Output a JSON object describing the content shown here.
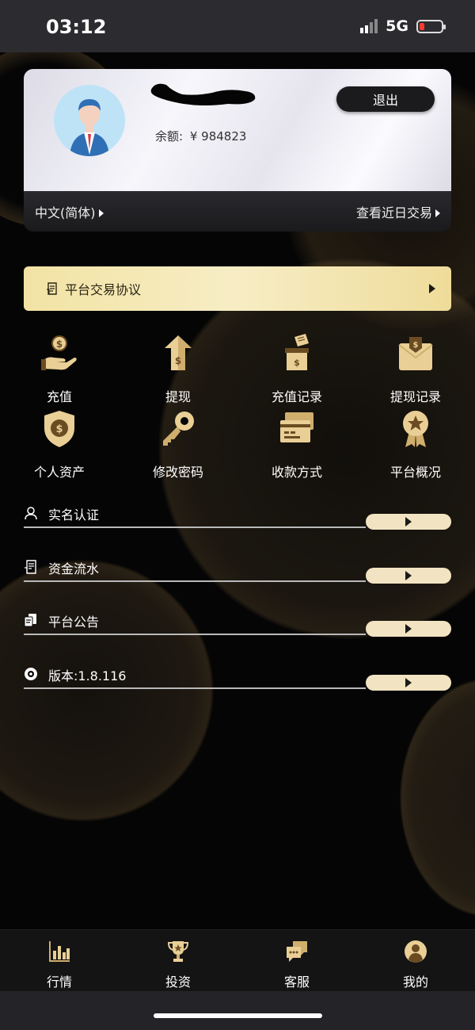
{
  "status_bar": {
    "time": "03:12",
    "network": "5G"
  },
  "profile": {
    "balance_label": "余额:",
    "balance_value": "¥ 984823",
    "logout_label": "退出",
    "language_label": "中文(简体)",
    "recent_trades_label": "查看近日交易"
  },
  "agreement": {
    "label": "平台交易协议"
  },
  "grid": {
    "items": [
      {
        "label": "充值",
        "icon": "hand-coin-icon"
      },
      {
        "label": "提现",
        "icon": "money-bag-up-icon"
      },
      {
        "label": "充值记录",
        "icon": "deposit-box-icon"
      },
      {
        "label": "提现记录",
        "icon": "envelope-shield-icon"
      },
      {
        "label": "个人资产",
        "icon": "shield-dollar-icon"
      },
      {
        "label": "修改密码",
        "icon": "key-icon"
      },
      {
        "label": "收款方式",
        "icon": "cards-icon"
      },
      {
        "label": "平台概况",
        "icon": "badge-star-icon"
      }
    ]
  },
  "menu": {
    "rows": [
      {
        "label": "实名认证",
        "icon": "user-icon"
      },
      {
        "label": "资金流水",
        "icon": "document-icon"
      },
      {
        "label": "平台公告",
        "icon": "notice-icon"
      },
      {
        "label": "版本:1.8.116",
        "icon": "disc-icon"
      }
    ]
  },
  "tabbar": {
    "tabs": [
      {
        "label": "行情",
        "icon": "bar-chart-icon"
      },
      {
        "label": "投资",
        "icon": "trophy-icon"
      },
      {
        "label": "客服",
        "icon": "chat-icon"
      },
      {
        "label": "我的",
        "icon": "profile-icon"
      }
    ]
  },
  "colors": {
    "gold": "#f2e3a4",
    "gold_icon": "#e9cf95",
    "background": "#050505"
  }
}
